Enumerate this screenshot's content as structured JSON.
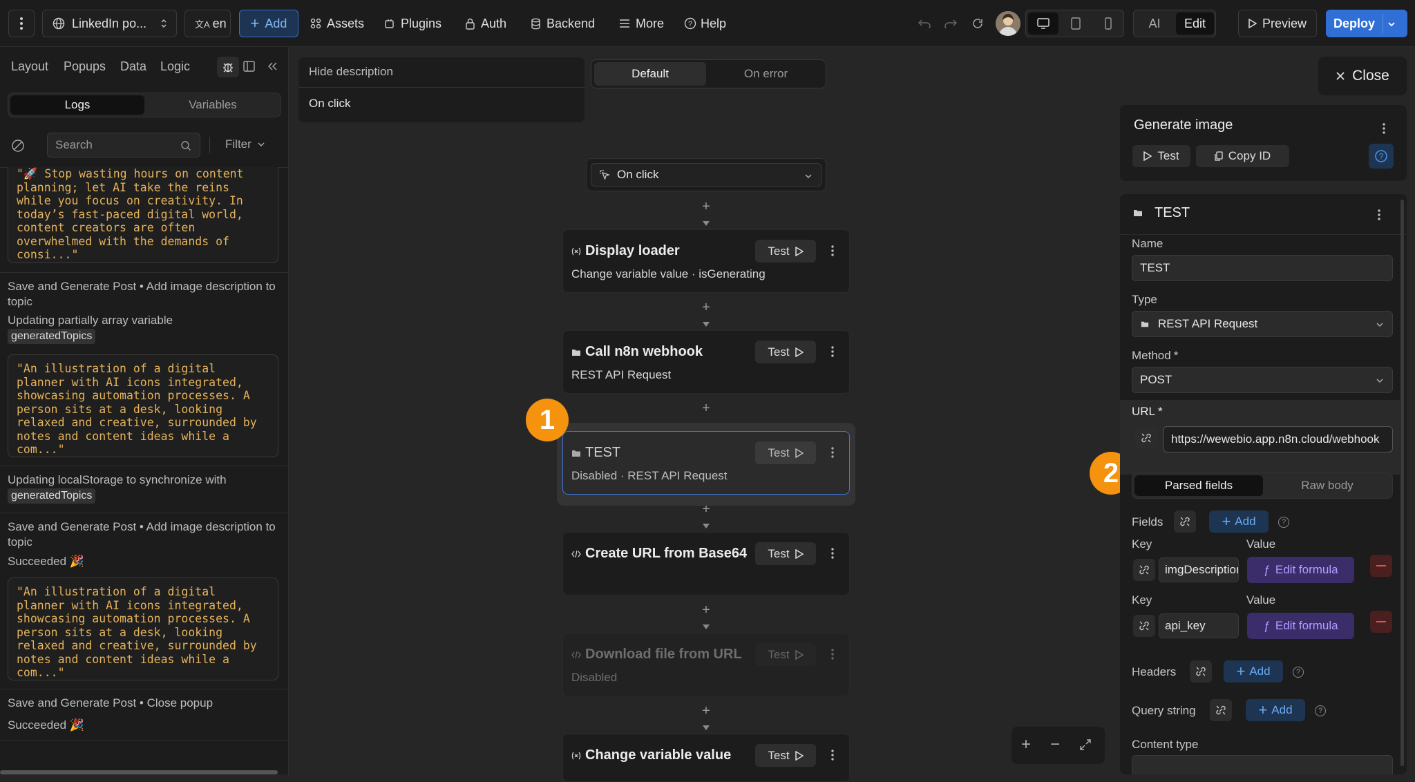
{
  "toolbar": {
    "project_name": "LinkedIn po...",
    "lang": "en",
    "add_label": "Add",
    "assets_label": "Assets",
    "plugins_label": "Plugins",
    "auth_label": "Auth",
    "backend_label": "Backend",
    "more_label": "More",
    "help_label": "Help",
    "ai_label": "AI",
    "edit_label": "Edit",
    "preview_label": "Preview",
    "deploy_label": "Deploy"
  },
  "sidebar": {
    "tabs": [
      "Layout",
      "Popups",
      "Data",
      "Logic"
    ],
    "logs_tab": "Logs",
    "variables_tab": "Variables",
    "search_placeholder": "Search",
    "filter_label": "Filter",
    "logs": {
      "code1": "\"🚀 Stop wasting hours on content\nplanning; let AI take the reins\nwhile you focus on creativity. In\ntoday’s fast-paced digital world,\ncontent creators are often\noverwhelmed with the demands of\nconsi...\"",
      "entry1": "Save and Generate Post • Add image description to topic",
      "entry2": "Updating partially array variable",
      "chip1": "generatedTopics",
      "code2": "\"An illustration of a digital\nplanner with AI icons integrated,\nshowcasing automation processes. A\nperson sits at a desk, looking\nrelaxed and creative, surrounded by\nnotes and content ideas while a\ncom...\"",
      "entry3": "Updating localStorage to synchronize with",
      "chip2": "generatedTopics",
      "entry4": "Save and Generate Post • Add image description to topic",
      "entry5": "Succeeded 🎉",
      "code3": "\"An illustration of a digital\nplanner with AI icons integrated,\nshowcasing automation processes. A\nperson sits at a desk, looking\nrelaxed and creative, surrounded by\nnotes and content ideas while a\ncom...\"",
      "entry6": "Save and Generate Post • Close popup",
      "entry7": "Succeeded 🎉"
    }
  },
  "canvas": {
    "hide_description": "Hide description",
    "trigger_desc": "On click",
    "mode_default": "Default",
    "mode_error": "On error",
    "trigger_select": "On click",
    "close_label": "Close",
    "nodes": [
      {
        "title": "Display loader",
        "sub": "Change variable value · isGenerating",
        "test": "Test"
      },
      {
        "title": "Call n8n webhook",
        "sub": "REST API Request",
        "test": "Test"
      },
      {
        "title": "TEST",
        "sub": "Disabled · REST API Request",
        "test": "Test"
      },
      {
        "title": "Create URL from Base64",
        "sub": "",
        "test": "Test"
      },
      {
        "title": "Download file from URL",
        "sub": "Disabled",
        "test": "Test"
      },
      {
        "title": "Change variable value",
        "sub": "",
        "test": "Test"
      }
    ],
    "badge1": "1",
    "badge2": "2"
  },
  "workflow_header": {
    "title": "Generate image",
    "test_label": "Test",
    "copy_id_label": "Copy ID"
  },
  "panel": {
    "title": "TEST",
    "name_label": "Name",
    "name_value": "TEST",
    "type_label": "Type",
    "type_value": "REST API Request",
    "method_label": "Method",
    "method_value": "POST",
    "url_label": "URL",
    "url_value": "https://wewebio.app.n8n.cloud/webhook",
    "required_mark": "*",
    "parsed_fields_tab": "Parsed fields",
    "raw_body_tab": "Raw body",
    "fields_label": "Fields",
    "add_label": "Add",
    "key_label": "Key",
    "value_label": "Value",
    "field1_key": "imgDescription",
    "field2_key": "api_key",
    "edit_formula_label": "Edit formula",
    "headers_label": "Headers",
    "query_label": "Query string",
    "content_type_label": "Content type"
  },
  "colors": {
    "accent": "#2f6fd6",
    "badge": "#f5930f",
    "selected_border": "#3a78d8"
  }
}
